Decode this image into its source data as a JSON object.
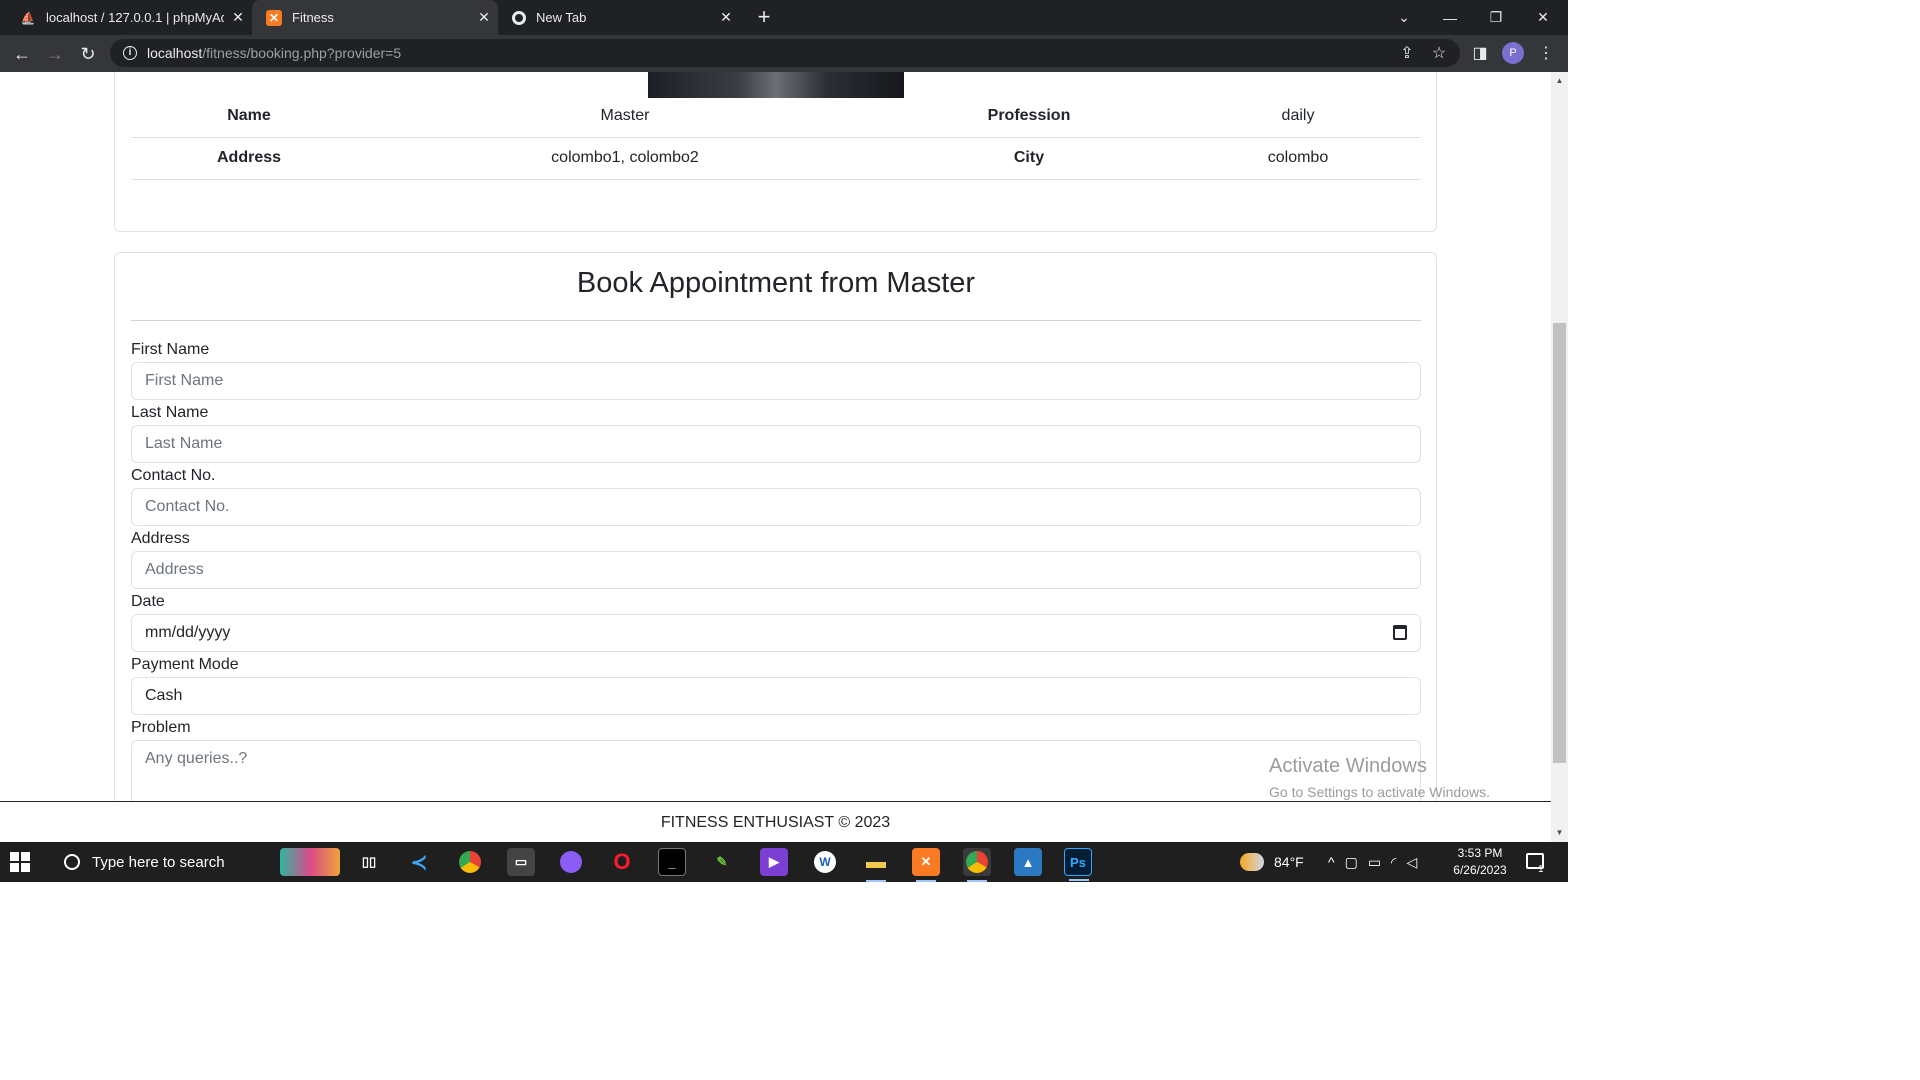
{
  "browser": {
    "tabs": [
      {
        "title": "localhost / 127.0.0.1 | phpMyAdm",
        "favicon": "phpmyadmin-icon",
        "active": false
      },
      {
        "title": "Fitness",
        "favicon": "xampp-icon",
        "active": true
      },
      {
        "title": "New Tab",
        "favicon": "chrome-icon",
        "active": false
      }
    ],
    "url_host": "localhost",
    "url_path": "/fitness/booking.php?provider=5",
    "profile_initial": "P"
  },
  "provider": {
    "rows": [
      {
        "k1": "Name",
        "v1": "Master",
        "k2": "Profession",
        "v2": "daily"
      },
      {
        "k1": "Address",
        "v1": "colombo1, colombo2",
        "k2": "City",
        "v2": "colombo"
      }
    ]
  },
  "form": {
    "title": "Book Appointment from Master",
    "first_name": {
      "label": "First Name",
      "placeholder": "First Name"
    },
    "last_name": {
      "label": "Last Name",
      "placeholder": "Last Name"
    },
    "contact": {
      "label": "Contact No.",
      "placeholder": "Contact No."
    },
    "address": {
      "label": "Address",
      "placeholder": "Address"
    },
    "date": {
      "label": "Date",
      "value": "mm/dd/yyyy"
    },
    "payment": {
      "label": "Payment Mode",
      "value": "Cash"
    },
    "problem": {
      "label": "Problem",
      "placeholder": "Any queries..?"
    }
  },
  "footer": {
    "text": "FITNESS ENTHUSIAST © 2023"
  },
  "watermark": {
    "line1": "Activate Windows",
    "line2": "Go to Settings to activate Windows."
  },
  "taskbar": {
    "search_placeholder": "Type here to search",
    "weather": "84°F",
    "time": "3:53 PM",
    "date": "6/26/2023",
    "notification_count": "1"
  }
}
